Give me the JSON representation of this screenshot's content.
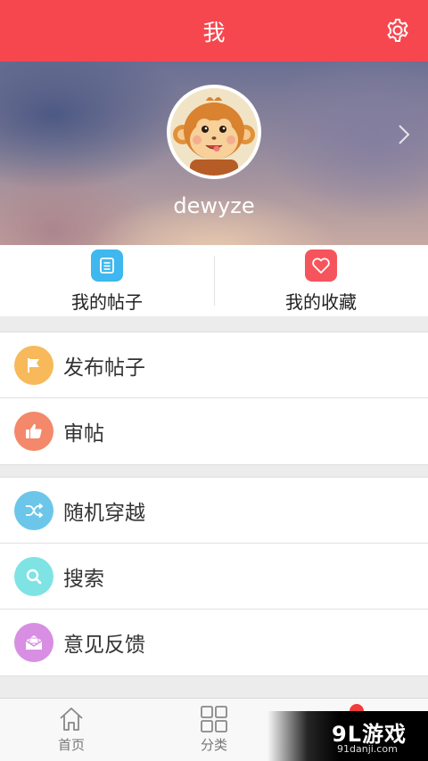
{
  "header": {
    "title": "我",
    "settings_icon": "gear-icon"
  },
  "profile": {
    "username": "dewyze",
    "avatar": "monkey-avatar",
    "arrow_icon": "chevron-right-icon"
  },
  "quick_actions": [
    {
      "label": "我的帖子",
      "icon": "document-icon",
      "color": "#3eb8ee"
    },
    {
      "label": "我的收藏",
      "icon": "heart-icon",
      "color": "#f6545c"
    }
  ],
  "menu_groups": [
    [
      {
        "label": "发布帖子",
        "icon": "flag-icon",
        "color": "#f7b95a"
      },
      {
        "label": "审帖",
        "icon": "thumbs-up-icon",
        "color": "#f4886b"
      }
    ],
    [
      {
        "label": "随机穿越",
        "icon": "shuffle-icon",
        "color": "#6cc6ea"
      },
      {
        "label": "搜索",
        "icon": "search-icon",
        "color": "#7fe3e4"
      },
      {
        "label": "意见反馈",
        "icon": "mail-icon",
        "color": "#d88ee3"
      }
    ]
  ],
  "tabbar": {
    "tabs": [
      {
        "label": "首页",
        "icon": "home-icon"
      },
      {
        "label": "分类",
        "icon": "grid-icon"
      },
      {
        "label": "",
        "icon": ""
      }
    ],
    "badge_color": "#f23b3b"
  },
  "watermark": {
    "logo": "9L游戏",
    "url": "91danji.com"
  }
}
